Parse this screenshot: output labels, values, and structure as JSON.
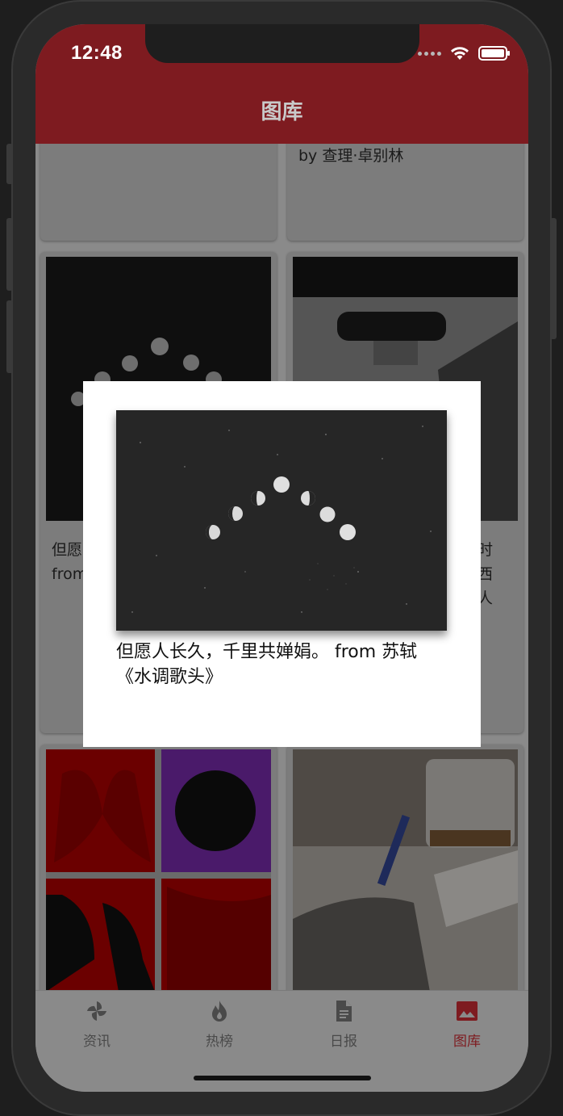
{
  "status_bar": {
    "time": "12:48"
  },
  "header": {
    "title": "图库"
  },
  "cards": {
    "top_right_text": "by 查理·卓别林",
    "mid_left_text_line1": "但愿",
    "mid_left_text_line2": "from",
    "mid_right_text_line1": "时",
    "mid_right_text_line2": "西",
    "mid_right_text_line3": "人"
  },
  "dialog": {
    "caption": "但愿人长久，千里共婵娟。 from 苏轼《水调歌头》"
  },
  "tabbar": {
    "items": [
      {
        "label": "资讯",
        "icon": "pinwheel-icon"
      },
      {
        "label": "热榜",
        "icon": "flame-icon"
      },
      {
        "label": "日报",
        "icon": "document-icon"
      },
      {
        "label": "图库",
        "icon": "image-icon"
      }
    ],
    "active_index": 3
  },
  "colors": {
    "header": "#7e1b20",
    "accent": "#7e1b20",
    "overlay": "#8a8a8a"
  }
}
